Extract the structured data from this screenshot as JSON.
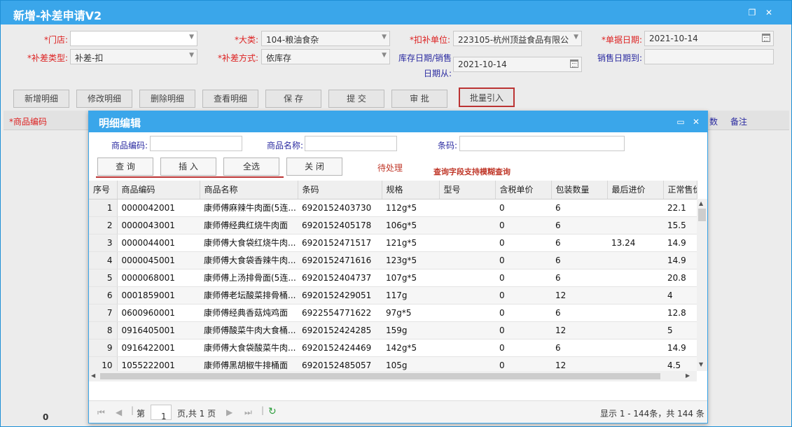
{
  "window": {
    "title": "新增-补差申请V2"
  },
  "form": {
    "store_label": "*门店:",
    "store_value": "",
    "category_label": "*大类:",
    "category_value": "104-粮油食杂",
    "deduct_unit_label": "*扣补单位:",
    "deduct_unit_value": "223105-杭州顶益食品有限公",
    "doc_date_label": "*单据日期:",
    "doc_date_value": "2021-10-14",
    "type_label": "*补差类型:",
    "type_value": "补差-扣",
    "method_label": "*补差方式:",
    "method_value": "依库存",
    "stock_date_label_1": "库存日期/销售",
    "stock_date_label_2": "日期从:",
    "stock_date_value": "2021-10-14",
    "sale_date_to_label": "销售日期到:",
    "sale_date_to_value": ""
  },
  "toolbar": {
    "add": "新增明细",
    "edit": "修改明细",
    "delete": "删除明细",
    "view": "查看明细",
    "save": "保 存",
    "submit": "提 交",
    "approve": "审 批",
    "batch": "批量引入"
  },
  "main_grid": {
    "col_code": "*商品编码",
    "col_qty_partial": "数",
    "col_remark": "备注",
    "footer_count": "0"
  },
  "dialog": {
    "title": "明细编辑",
    "code_label": "商品编码:",
    "name_label": "商品名称:",
    "barcode_label": "条码:",
    "query_btn": "查 询",
    "insert_btn": "插 入",
    "select_all_btn": "全选",
    "close_btn": "关 闭",
    "pending_note": "待处理",
    "fuzzy_note": "查询字段支持模糊查询",
    "columns": [
      "序号",
      "商品编码",
      "商品名称",
      "条码",
      "规格",
      "型号",
      "含税单价",
      "包装数量",
      "最后进价",
      "正常售价"
    ],
    "rows": [
      [
        "1",
        "0000042001",
        "康师傅麻辣牛肉面(5连...",
        "6920152403730",
        "112g*5",
        "",
        "0",
        "6",
        "",
        "22.1"
      ],
      [
        "2",
        "0000043001",
        "康师傅经典红烧牛肉面",
        "6920152405178",
        "106g*5",
        "",
        "0",
        "6",
        "",
        "15.5"
      ],
      [
        "3",
        "0000044001",
        "康师傅大食袋红烧牛肉...",
        "6920152471517",
        "121g*5",
        "",
        "0",
        "6",
        "13.24",
        "14.9"
      ],
      [
        "4",
        "0000045001",
        "康师傅大食袋香辣牛肉...",
        "6920152471616",
        "123g*5",
        "",
        "0",
        "6",
        "",
        "14.9"
      ],
      [
        "5",
        "0000068001",
        "康师傅上汤排骨面(5连...",
        "6920152404737",
        "107g*5",
        "",
        "0",
        "6",
        "",
        "20.8"
      ],
      [
        "6",
        "0001859001",
        "康师傅老坛酸菜排骨桶...",
        "6920152429051",
        "117g",
        "",
        "0",
        "12",
        "",
        "4"
      ],
      [
        "7",
        "0600960001",
        "康师傅经典香菇炖鸡面",
        "6922554771622",
        "97g*5",
        "",
        "0",
        "6",
        "",
        "12.8"
      ],
      [
        "8",
        "0916405001",
        "康师傅酸菜牛肉大食桶...",
        "6920152424285",
        "159g",
        "",
        "0",
        "12",
        "",
        "5"
      ],
      [
        "9",
        "0916422001",
        "康师傅大食袋酸菜牛肉...",
        "6920152424469",
        "142g*5",
        "",
        "0",
        "6",
        "",
        "14.9"
      ],
      [
        "10",
        "1055222001",
        "康师傅黑胡椒牛排桶面",
        "6920152485057",
        "105g",
        "",
        "0",
        "12",
        "",
        "4.5"
      ]
    ],
    "pager": {
      "page_prefix": "第",
      "page_value": "1",
      "page_suffix": "页,共 1 页",
      "summary": "显示 1 - 144条，共 144 条"
    }
  },
  "colors": {
    "title_bar": "#3aa6ea",
    "required_label": "#d22222",
    "label": "#2a2aa0",
    "annotation": "#c0392b"
  }
}
